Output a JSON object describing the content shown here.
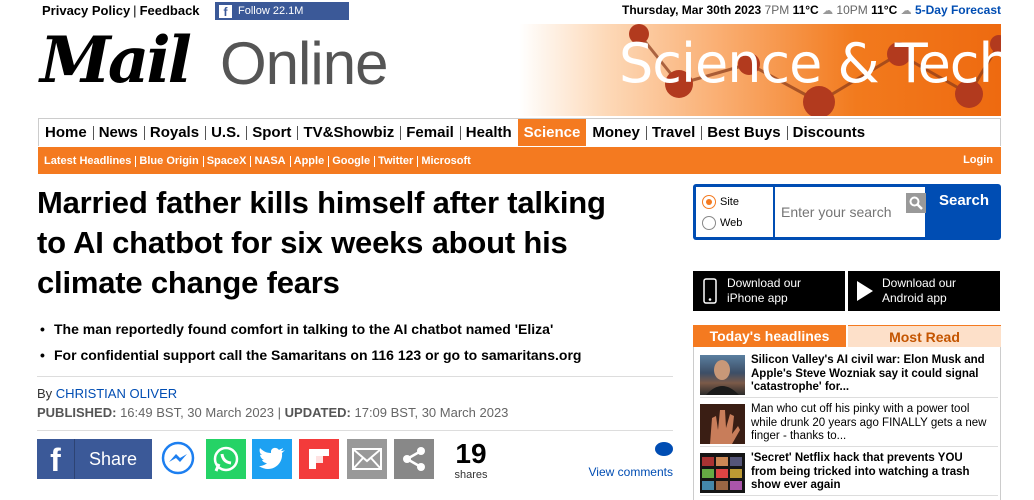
{
  "topbar": {
    "privacy": "Privacy Policy",
    "feedback": "Feedback",
    "follow": "Follow 22.1M",
    "date": "Thursday, Mar 30th 2023",
    "t1_time": "7PM",
    "t1_temp": "11°C",
    "t2_time": "10PM",
    "t2_temp": "11°C",
    "forecast": "5-Day Forecast"
  },
  "masthead": {
    "logo_mail": "Mail",
    "logo_online": "Online",
    "channel_title": "Science & Tech"
  },
  "nav": {
    "items": [
      "Home",
      "News",
      "Royals",
      "U.S.",
      "Sport",
      "TV&Showbiz",
      "Femail",
      "Health",
      "Science",
      "Money",
      "Travel",
      "Best Buys",
      "Discounts"
    ],
    "active": "Science"
  },
  "subnav": {
    "items": [
      "Latest Headlines",
      "Blue Origin",
      "SpaceX",
      "NASA",
      "Apple",
      "Google",
      "Twitter",
      "Microsoft"
    ],
    "login": "Login"
  },
  "article": {
    "headline": "Married father kills himself after talking to AI chatbot for six weeks about his climate change fears",
    "bullets": [
      "The man reportedly found comfort in talking to the AI chatbot named 'Eliza'",
      "For confidential support call the Samaritans on 116 123 or go to samaritans.org"
    ],
    "by": "By",
    "author": "CHRISTIAN OLIVER",
    "published_label": "PUBLISHED:",
    "published": "16:49 BST, 30 March 2023",
    "sep": "|",
    "updated_label": "UPDATED:",
    "updated": "17:09 BST, 30 March 2023"
  },
  "share": {
    "share_label": "Share",
    "count": "19",
    "count_label": "shares",
    "comments": "View comments"
  },
  "search": {
    "site": "Site",
    "web": "Web",
    "placeholder": "Enter your search",
    "button": "Search"
  },
  "apps": {
    "iphone": [
      "Download our",
      "iPhone app"
    ],
    "android": [
      "Download our",
      "Android app"
    ]
  },
  "headlines": {
    "tab_today": "Today's headlines",
    "tab_most": "Most Read",
    "items": [
      "Silicon Valley's AI civil war: Elon Musk and Apple's Steve Wozniak say it could signal 'catastrophe' for...",
      "Man who cut off his pinky with a power tool while drunk 20 years ago FINALLY gets a new finger - thanks to...",
      "'Secret' Netflix hack that prevents YOU from being tricked into watching a trash show ever again"
    ]
  },
  "colors": {
    "accent": "#f47a20",
    "link": "#004db3",
    "facebook": "#3b5998"
  }
}
